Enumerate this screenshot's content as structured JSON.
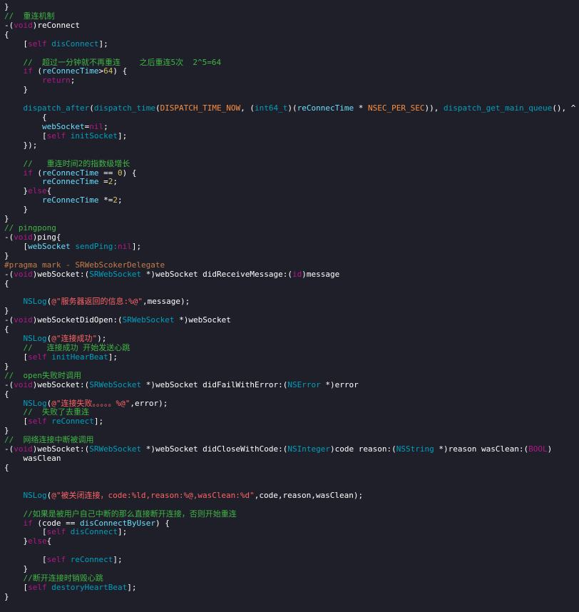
{
  "theme": {
    "background": "#1e1f29",
    "plain": "#ffffff",
    "comment": "#41b645",
    "keyword": "#b21889",
    "selfkw": "#b21889",
    "type": "#00a0be",
    "type2": "#ffffff",
    "method": "#00a0be",
    "ivar": "#6bdfff",
    "string": "#ff6466",
    "number": "#d5c25f",
    "pragma": "#c77c48",
    "macro": "#fd8f3f"
  },
  "lines": [
    [
      [
        "plain",
        "}"
      ]
    ],
    [
      [
        "comment",
        "//  重连机制"
      ]
    ],
    [
      [
        "plain",
        "-("
      ],
      [
        "keyword",
        "void"
      ],
      [
        "plain",
        ")reConnect"
      ]
    ],
    [
      [
        "plain",
        "{"
      ]
    ],
    [
      [
        "plain",
        "    ["
      ],
      [
        "selfkw",
        "self"
      ],
      [
        "method",
        " disConnect"
      ],
      [
        "plain",
        "];"
      ]
    ],
    [],
    [
      [
        "comment",
        "    //  超过一分钟就不再重连    之后重连5次  2^5=64"
      ]
    ],
    [
      [
        "plain",
        "    "
      ],
      [
        "keyword",
        "if"
      ],
      [
        "plain",
        " ("
      ],
      [
        "ivar",
        "reConnecTime"
      ],
      [
        "plain",
        ">"
      ],
      [
        "number",
        "64"
      ],
      [
        "plain",
        ") {"
      ]
    ],
    [
      [
        "plain",
        "        "
      ],
      [
        "keyword",
        "return"
      ],
      [
        "plain",
        ";"
      ]
    ],
    [
      [
        "plain",
        "    }"
      ]
    ],
    [],
    [
      [
        "method",
        "    dispatch_after"
      ],
      [
        "plain",
        "("
      ],
      [
        "method",
        "dispatch_time"
      ],
      [
        "plain",
        "("
      ],
      [
        "macro",
        "DISPATCH_TIME_NOW"
      ],
      [
        "plain",
        ", ("
      ],
      [
        "type",
        "int64_t"
      ],
      [
        "plain",
        ")("
      ],
      [
        "ivar",
        "reConnecTime"
      ],
      [
        "plain",
        " * "
      ],
      [
        "macro",
        "NSEC_PER_SEC"
      ],
      [
        "plain",
        ")), "
      ],
      [
        "method",
        "dispatch_get_main_queue"
      ],
      [
        "plain",
        "(), ^"
      ]
    ],
    [
      [
        "plain",
        "        {"
      ]
    ],
    [
      [
        "plain",
        "        "
      ],
      [
        "ivar",
        "webSocket"
      ],
      [
        "plain",
        "="
      ],
      [
        "keyword",
        "nil"
      ],
      [
        "plain",
        ";"
      ]
    ],
    [
      [
        "plain",
        "        ["
      ],
      [
        "selfkw",
        "self"
      ],
      [
        "method",
        " initSocket"
      ],
      [
        "plain",
        "];"
      ]
    ],
    [
      [
        "plain",
        "    });"
      ]
    ],
    [],
    [
      [
        "comment",
        "    //   重连时间2的指数级增长"
      ]
    ],
    [
      [
        "plain",
        "    "
      ],
      [
        "keyword",
        "if"
      ],
      [
        "plain",
        " ("
      ],
      [
        "ivar",
        "reConnecTime"
      ],
      [
        "plain",
        " == "
      ],
      [
        "number",
        "0"
      ],
      [
        "plain",
        ") {"
      ]
    ],
    [
      [
        "plain",
        "        "
      ],
      [
        "ivar",
        "reConnecTime"
      ],
      [
        "plain",
        " ="
      ],
      [
        "number",
        "2"
      ],
      [
        "plain",
        ";"
      ]
    ],
    [
      [
        "plain",
        "    }"
      ],
      [
        "keyword",
        "else"
      ],
      [
        "plain",
        "{"
      ]
    ],
    [
      [
        "plain",
        "        "
      ],
      [
        "ivar",
        "reConnecTime"
      ],
      [
        "plain",
        " *="
      ],
      [
        "number",
        "2"
      ],
      [
        "plain",
        ";"
      ]
    ],
    [
      [
        "plain",
        "    }"
      ]
    ],
    [
      [
        "plain",
        "}"
      ]
    ],
    [
      [
        "comment",
        "// pingpong"
      ]
    ],
    [
      [
        "plain",
        "-("
      ],
      [
        "keyword",
        "void"
      ],
      [
        "plain",
        ")ping{"
      ]
    ],
    [
      [
        "plain",
        "    ["
      ],
      [
        "ivar",
        "webSocket"
      ],
      [
        "method",
        " sendPing:"
      ],
      [
        "keyword",
        "nil"
      ],
      [
        "plain",
        "];"
      ]
    ],
    [
      [
        "plain",
        "}"
      ]
    ],
    [
      [
        "pragma",
        "#pragma mark - SRWebScokerDelegate"
      ]
    ],
    [
      [
        "plain",
        "-("
      ],
      [
        "keyword",
        "void"
      ],
      [
        "plain",
        ")webSocket:("
      ],
      [
        "type",
        "SRWebSocket"
      ],
      [
        "plain",
        " *)webSocket didReceiveMessage:("
      ],
      [
        "keyword",
        "id"
      ],
      [
        "plain",
        ")message"
      ]
    ],
    [
      [
        "plain",
        "{"
      ]
    ],
    [],
    [
      [
        "plain",
        "    "
      ],
      [
        "method",
        "NSLog"
      ],
      [
        "plain",
        "("
      ],
      [
        "string",
        "@\"服务器返回的信息:%@\""
      ],
      [
        "plain",
        ",message);"
      ]
    ],
    [
      [
        "plain",
        "}"
      ]
    ],
    [
      [
        "plain",
        "-("
      ],
      [
        "keyword",
        "void"
      ],
      [
        "plain",
        ")webSocketDidOpen:("
      ],
      [
        "type",
        "SRWebSocket"
      ],
      [
        "plain",
        " *)webSocket"
      ]
    ],
    [
      [
        "plain",
        "{"
      ]
    ],
    [
      [
        "plain",
        "    "
      ],
      [
        "method",
        "NSLog"
      ],
      [
        "plain",
        "("
      ],
      [
        "string",
        "@\"连接成功\""
      ],
      [
        "plain",
        ");"
      ]
    ],
    [
      [
        "comment",
        "    //   连接成功 开始发送心跳"
      ]
    ],
    [
      [
        "plain",
        "    ["
      ],
      [
        "selfkw",
        "self"
      ],
      [
        "method",
        " initHearBeat"
      ],
      [
        "plain",
        "];"
      ]
    ],
    [
      [
        "plain",
        "}"
      ]
    ],
    [
      [
        "comment",
        "//  open失败时调用"
      ]
    ],
    [
      [
        "plain",
        "-("
      ],
      [
        "keyword",
        "void"
      ],
      [
        "plain",
        ")webSocket:("
      ],
      [
        "type",
        "SRWebSocket"
      ],
      [
        "plain",
        " *)webSocket didFailWithError:("
      ],
      [
        "type",
        "NSError"
      ],
      [
        "plain",
        " *)error"
      ]
    ],
    [
      [
        "plain",
        "{"
      ]
    ],
    [
      [
        "plain",
        "    "
      ],
      [
        "method",
        "NSLog"
      ],
      [
        "plain",
        "("
      ],
      [
        "string",
        "@\"连接失败。。。。。%@\""
      ],
      [
        "plain",
        ",error);"
      ]
    ],
    [
      [
        "comment",
        "    //  失败了去重连"
      ]
    ],
    [
      [
        "plain",
        "    ["
      ],
      [
        "selfkw",
        "self"
      ],
      [
        "method",
        " reConnect"
      ],
      [
        "plain",
        "];"
      ]
    ],
    [
      [
        "plain",
        "}"
      ]
    ],
    [
      [
        "comment",
        "//  网络连接中断被调用"
      ]
    ],
    [
      [
        "plain",
        "-("
      ],
      [
        "keyword",
        "void"
      ],
      [
        "plain",
        ")webSocket:("
      ],
      [
        "type",
        "SRWebSocket"
      ],
      [
        "plain",
        " *)webSocket didCloseWithCode:("
      ],
      [
        "type",
        "NSInteger"
      ],
      [
        "plain",
        ")code reason:("
      ],
      [
        "type",
        "NSString"
      ],
      [
        "plain",
        " *)reason wasClean:("
      ],
      [
        "keyword",
        "BOOL"
      ],
      [
        "plain",
        ")"
      ]
    ],
    [
      [
        "plain",
        "    wasClean"
      ]
    ],
    [
      [
        "plain",
        "{"
      ]
    ],
    [],
    [],
    [
      [
        "plain",
        "    "
      ],
      [
        "method",
        "NSLog"
      ],
      [
        "plain",
        "("
      ],
      [
        "string",
        "@\"被关闭连接，code:%ld,reason:%@,wasClean:%d\""
      ],
      [
        "plain",
        ",code,reason,wasClean);"
      ]
    ],
    [],
    [
      [
        "comment",
        "    //如果是被用户自己中断的那么直接断开连接，否则开始重连"
      ]
    ],
    [
      [
        "plain",
        "    "
      ],
      [
        "keyword",
        "if"
      ],
      [
        "plain",
        " (code == "
      ],
      [
        "ivar",
        "disConnectByUser"
      ],
      [
        "plain",
        ") {"
      ]
    ],
    [
      [
        "plain",
        "        ["
      ],
      [
        "selfkw",
        "self"
      ],
      [
        "method",
        " disConnect"
      ],
      [
        "plain",
        "];"
      ]
    ],
    [
      [
        "plain",
        "    }"
      ],
      [
        "keyword",
        "else"
      ],
      [
        "plain",
        "{"
      ]
    ],
    [],
    [
      [
        "plain",
        "        ["
      ],
      [
        "selfkw",
        "self"
      ],
      [
        "method",
        " reConnect"
      ],
      [
        "plain",
        "];"
      ]
    ],
    [
      [
        "plain",
        "    }"
      ]
    ],
    [
      [
        "comment",
        "    //断开连接时销毁心跳"
      ]
    ],
    [
      [
        "plain",
        "    ["
      ],
      [
        "selfkw",
        "self"
      ],
      [
        "method",
        " destoryHeartBeat"
      ],
      [
        "plain",
        "];"
      ]
    ],
    [
      [
        "plain",
        "}"
      ]
    ]
  ]
}
